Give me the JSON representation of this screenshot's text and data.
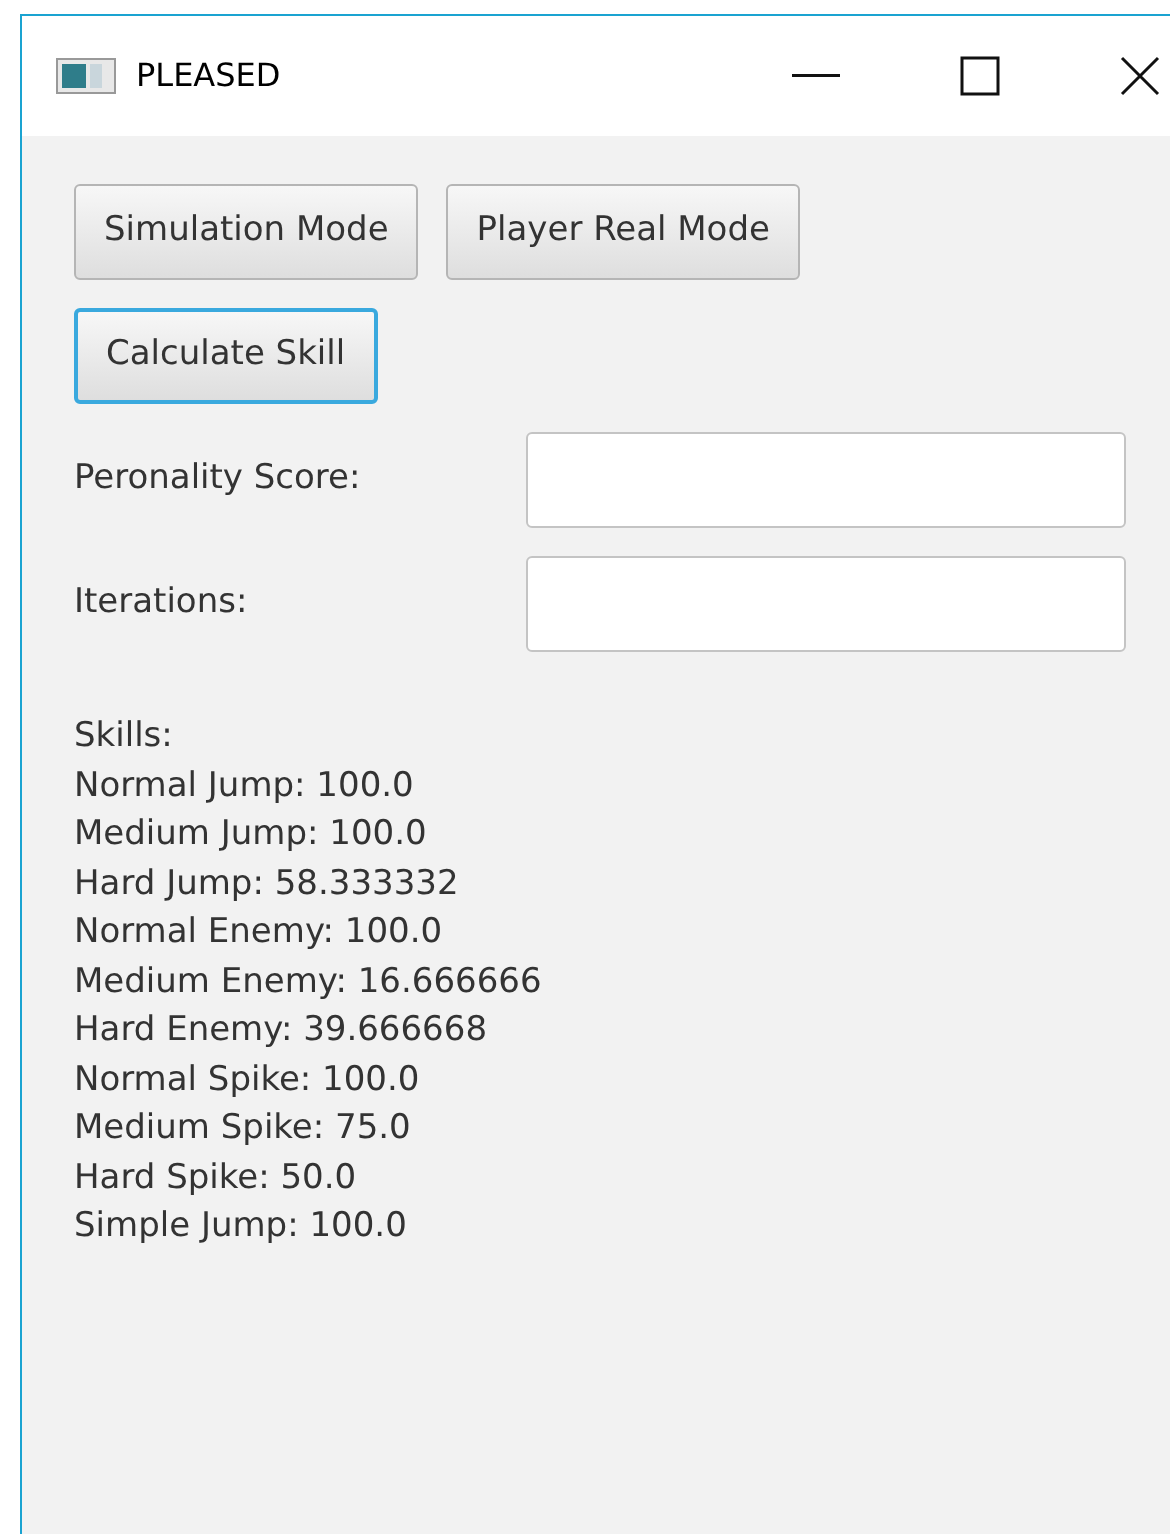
{
  "window": {
    "title": "PLEASED"
  },
  "buttons": [
    {
      "label": "Simulation Mode",
      "focused": false
    },
    {
      "label": "Player Real Mode",
      "focused": false
    },
    {
      "label": "Calculate Skill",
      "focused": true
    }
  ],
  "fields": [
    {
      "label": "Peronality Score:"
    },
    {
      "label": "Iterations:"
    }
  ],
  "skills": [
    "Skills:",
    "Normal Jump: 100.0",
    "Medium Jump: 100.0",
    "Hard Jump: 58.333332",
    "Normal Enemy: 100.0",
    "Medium Enemy: 16.666666",
    "Hard Enemy: 39.666668",
    "Normal Spike: 100.0",
    "Medium Spike: 75.0",
    "Hard Spike: 50.0",
    "Simple Jump: 100.0"
  ]
}
